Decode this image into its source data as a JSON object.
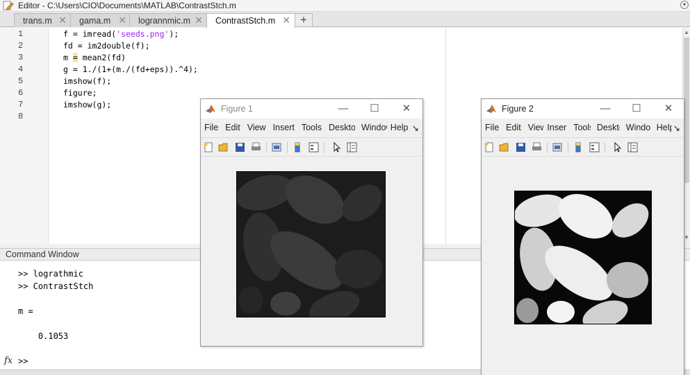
{
  "editor": {
    "title": "Editor - C:\\Users\\CIO\\Documents\\MATLAB\\ContrastStch.m",
    "tabs": [
      {
        "label": "trans.m"
      },
      {
        "label": "gama.m"
      },
      {
        "label": "logrannmic.m"
      },
      {
        "label": "ContrastStch.m"
      }
    ],
    "line_numbers": [
      "1",
      "2",
      "3",
      "4",
      "5",
      "6",
      "7",
      "8"
    ],
    "code": {
      "l1_a": "f = imread(",
      "l1_str": "'seeds.png'",
      "l1_b": ");",
      "l2": "fd = im2double(f);",
      "l3_a": "m ",
      "l3_eq": "=",
      "l3_b": " mean2(fd)",
      "l4": "g = 1./(1+(m./(fd+eps)).^4);",
      "l5": "imshow(f);",
      "l6": "figure;",
      "l7": "imshow(g);"
    }
  },
  "command_window": {
    "header": "Command Window",
    "lines": [
      ">> lograthmic",
      ">> ContrastStch",
      "",
      "m =",
      "",
      "    0.1053"
    ],
    "fx": "fx",
    "prompt": ">>"
  },
  "figures": [
    {
      "title": "Figure 1",
      "menu": [
        "File",
        "Edit",
        "View",
        "Insert",
        "Tools",
        "Desktop",
        "Window",
        "Help"
      ]
    },
    {
      "title": "Figure 2",
      "menu": [
        "File",
        "Edit",
        "View",
        "Inser",
        "Tools",
        "Deskto",
        "Window",
        "Help"
      ]
    }
  ],
  "colors": {
    "string": "#a020f0",
    "highlight": "#f6eba8"
  }
}
